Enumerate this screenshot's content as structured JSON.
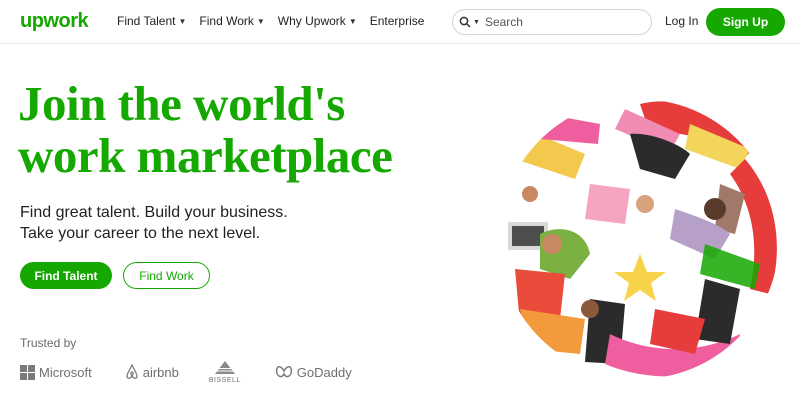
{
  "header": {
    "logo": "upwork",
    "nav": [
      {
        "label": "Find Talent",
        "has_dropdown": true
      },
      {
        "label": "Find Work",
        "has_dropdown": true
      },
      {
        "label": "Why Upwork",
        "has_dropdown": true
      },
      {
        "label": "Enterprise",
        "has_dropdown": false
      }
    ],
    "search": {
      "placeholder": "Search",
      "value": "",
      "icon": "search-icon"
    },
    "login_label": "Log In",
    "signup_label": "Sign Up"
  },
  "hero": {
    "title_lines": [
      "Join the world's",
      "work marketplace"
    ],
    "subtitle_lines": [
      "Find great talent. Build your business.",
      "Take your career to the next level."
    ],
    "primary_button": "Find Talent",
    "secondary_button": "Find Work"
  },
  "trusted": {
    "label": "Trusted by",
    "brands": [
      {
        "name": "Microsoft",
        "icon": "microsoft-logo-icon"
      },
      {
        "name": "airbnb",
        "icon": "airbnb-logo-icon"
      },
      {
        "name": "BISSELL",
        "icon": "bissell-logo-icon"
      },
      {
        "name": "GoDaddy",
        "icon": "godaddy-logo-icon"
      }
    ]
  },
  "colors": {
    "brand_green": "#14a800",
    "text": "#222222",
    "muted": "#6f6f6f"
  }
}
